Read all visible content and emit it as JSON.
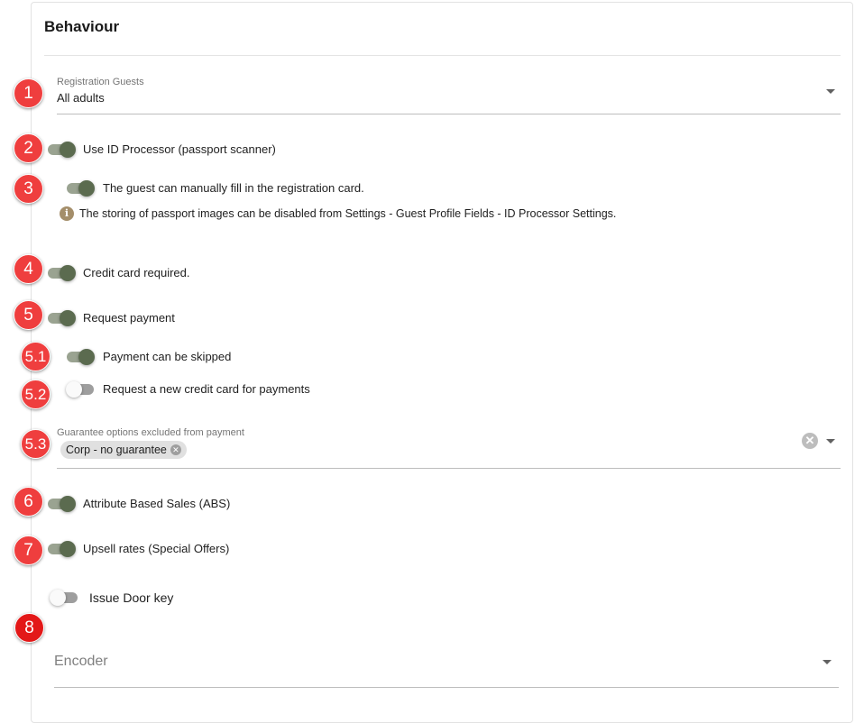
{
  "section": {
    "title": "Behaviour"
  },
  "registration_guests": {
    "label": "Registration Guests",
    "value": "All adults"
  },
  "toggles": {
    "id_processor": {
      "label": "Use ID Processor (passport scanner)",
      "state": "on"
    },
    "manual_fill": {
      "label": "The guest can manually fill in the registration card.",
      "state": "on"
    },
    "credit_card_required": {
      "label": "Credit card required.",
      "state": "on"
    },
    "request_payment": {
      "label": "Request payment",
      "state": "on"
    },
    "payment_skipped": {
      "label": "Payment can be skipped",
      "state": "on"
    },
    "new_credit_card": {
      "label": "Request a new credit card for payments",
      "state": "off"
    },
    "abs": {
      "label": "Attribute Based Sales (ABS)",
      "state": "on"
    },
    "upsell": {
      "label": "Upsell rates (Special Offers)",
      "state": "on"
    },
    "door_key": {
      "label": "Issue Door key",
      "state": "off"
    }
  },
  "info_note": {
    "icon": "info-icon",
    "text": "The storing of passport images can be disabled from Settings - Guest Profile Fields - ID Processor Settings."
  },
  "guarantee_excluded": {
    "label": "Guarantee options excluded from payment",
    "chips": [
      "Corp - no guarantee"
    ]
  },
  "encoder": {
    "placeholder": "Encoder"
  },
  "badges": [
    "1",
    "2",
    "3",
    "4",
    "5",
    "5.1",
    "5.2",
    "5.3",
    "6",
    "7",
    "8"
  ],
  "colors": {
    "toggle_on_thumb": "#5b6b4f",
    "toggle_on_track": "#9aa391",
    "badge_red": "#ef3e3e",
    "info_icon": "#a48e6a"
  }
}
